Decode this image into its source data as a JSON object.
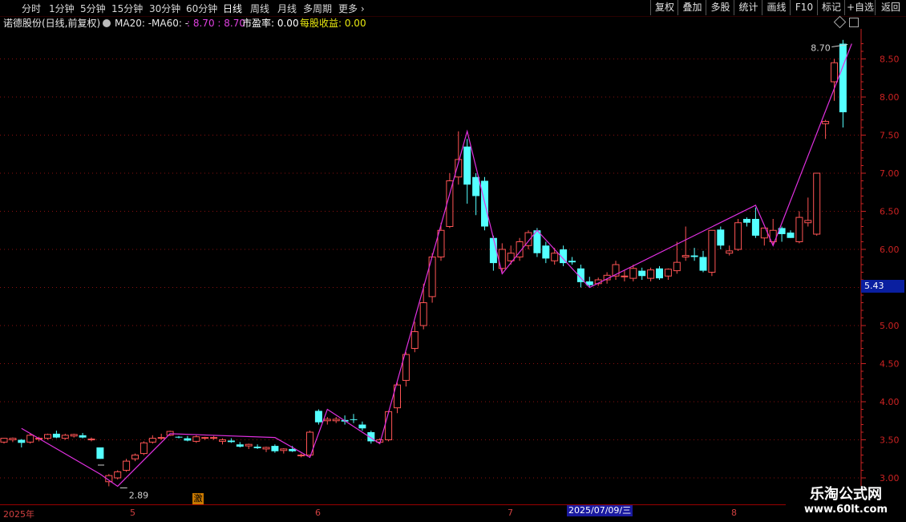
{
  "toolbar": {
    "periods": [
      "分时",
      "1分钟",
      "5分钟",
      "15分钟",
      "30分钟",
      "60分钟",
      "日线",
      "周线",
      "月线",
      "多周期",
      "更多 ›"
    ],
    "active_period": "日线",
    "right_buttons": [
      "复权",
      "叠加",
      "多股",
      "统计",
      "画线",
      "F10",
      "标记",
      "+自选",
      "返回"
    ]
  },
  "info": {
    "stock": "诺德股份(日线,前复权)",
    "ma20_label": "MA20: -",
    "ma60_label": "MA60: -",
    "ma_values": ": 8.70 : 8.70",
    "pe_label": "市盈率: 0.00",
    "eps_label": "每股收益: 0.00"
  },
  "panel_icons": [
    "diamond-icon",
    "window-icon"
  ],
  "current_price_tag": "5.43",
  "annotations": {
    "low_label": "2.89",
    "high_label": "8.70",
    "signal_flag": "激"
  },
  "date_axis": {
    "labels": [
      "2025年",
      "5",
      "6",
      "7",
      "8"
    ],
    "cursor_date": "2025/07/09/三"
  },
  "watermark": {
    "title": "乐淘公式网",
    "url": "www.60lt.com"
  },
  "colors": {
    "up": "#ff5454",
    "down": "#54ffff",
    "zigzag": "#e030e0",
    "axis": "#cc2222",
    "grid": "#8a1010"
  },
  "chart_data": {
    "type": "candlestick",
    "y_ticks": [
      3.0,
      3.5,
      4.0,
      4.5,
      5.0,
      5.5,
      6.0,
      6.5,
      7.0,
      7.5,
      8.0,
      8.5
    ],
    "ylim": [
      2.9,
      8.8
    ],
    "candles": [
      [
        3.47,
        3.52,
        3.45,
        3.52
      ],
      [
        3.5,
        3.53,
        3.47,
        3.52
      ],
      [
        3.5,
        3.51,
        3.4,
        3.46
      ],
      [
        3.47,
        3.58,
        3.45,
        3.56
      ],
      [
        3.51,
        3.54,
        3.48,
        3.52
      ],
      [
        3.52,
        3.58,
        3.5,
        3.57
      ],
      [
        3.58,
        3.62,
        3.52,
        3.53
      ],
      [
        3.52,
        3.58,
        3.5,
        3.56
      ],
      [
        3.55,
        3.58,
        3.53,
        3.57
      ],
      [
        3.56,
        3.59,
        3.52,
        3.53
      ],
      [
        3.5,
        3.53,
        3.48,
        3.51
      ],
      [
        3.4,
        3.4,
        3.25,
        3.25
      ],
      [
        2.95,
        3.05,
        2.89,
        3.03
      ],
      [
        3.0,
        3.1,
        2.98,
        3.08
      ],
      [
        3.1,
        3.25,
        3.08,
        3.22
      ],
      [
        3.25,
        3.32,
        3.22,
        3.3
      ],
      [
        3.32,
        3.48,
        3.3,
        3.46
      ],
      [
        3.47,
        3.56,
        3.45,
        3.52
      ],
      [
        3.52,
        3.58,
        3.5,
        3.53
      ],
      [
        3.56,
        3.62,
        3.55,
        3.61
      ],
      [
        3.54,
        3.55,
        3.52,
        3.53
      ],
      [
        3.52,
        3.55,
        3.48,
        3.49
      ],
      [
        3.48,
        3.56,
        3.46,
        3.54
      ],
      [
        3.52,
        3.54,
        3.5,
        3.53
      ],
      [
        3.52,
        3.55,
        3.5,
        3.53
      ],
      [
        3.48,
        3.52,
        3.44,
        3.5
      ],
      [
        3.49,
        3.52,
        3.46,
        3.47
      ],
      [
        3.44,
        3.47,
        3.4,
        3.41
      ],
      [
        3.42,
        3.45,
        3.38,
        3.44
      ],
      [
        3.41,
        3.44,
        3.38,
        3.39
      ],
      [
        3.38,
        3.41,
        3.34,
        3.4
      ],
      [
        3.42,
        3.44,
        3.33,
        3.35
      ],
      [
        3.36,
        3.39,
        3.32,
        3.38
      ],
      [
        3.38,
        3.42,
        3.34,
        3.35
      ],
      [
        3.3,
        3.32,
        3.27,
        3.3
      ],
      [
        3.3,
        3.62,
        3.28,
        3.6
      ],
      [
        3.88,
        3.9,
        3.7,
        3.73
      ],
      [
        3.75,
        3.8,
        3.7,
        3.77
      ],
      [
        3.75,
        3.8,
        3.72,
        3.77
      ],
      [
        3.76,
        3.82,
        3.7,
        3.74
      ],
      [
        3.77,
        3.84,
        3.72,
        3.76
      ],
      [
        3.7,
        3.74,
        3.62,
        3.65
      ],
      [
        3.6,
        3.62,
        3.45,
        3.48
      ],
      [
        3.47,
        3.52,
        3.45,
        3.5
      ],
      [
        3.5,
        3.88,
        3.48,
        3.87
      ],
      [
        3.92,
        4.25,
        3.85,
        4.22
      ],
      [
        4.28,
        4.65,
        4.2,
        4.62
      ],
      [
        4.7,
        5.05,
        4.65,
        4.92
      ],
      [
        5.0,
        5.55,
        4.95,
        5.3
      ],
      [
        5.38,
        5.95,
        5.3,
        5.9
      ],
      [
        5.9,
        6.35,
        5.85,
        6.25
      ],
      [
        6.3,
        7.0,
        6.28,
        6.9
      ],
      [
        6.95,
        7.55,
        6.85,
        7.18
      ],
      [
        7.35,
        7.45,
        6.6,
        6.85
      ],
      [
        6.95,
        7.0,
        6.45,
        6.7
      ],
      [
        6.9,
        6.95,
        6.25,
        6.3
      ],
      [
        6.15,
        6.18,
        5.72,
        5.82
      ],
      [
        5.75,
        6.08,
        5.7,
        6.0
      ],
      [
        5.85,
        6.05,
        5.8,
        5.95
      ],
      [
        5.9,
        6.15,
        5.85,
        6.1
      ],
      [
        6.05,
        6.25,
        6.0,
        6.22
      ],
      [
        6.25,
        6.28,
        5.9,
        5.95
      ],
      [
        6.05,
        6.1,
        5.82,
        5.88
      ],
      [
        5.85,
        6.02,
        5.8,
        5.95
      ],
      [
        6.0,
        6.05,
        5.78,
        5.82
      ],
      [
        5.85,
        5.9,
        5.8,
        5.83
      ],
      [
        5.75,
        5.8,
        5.5,
        5.57
      ],
      [
        5.58,
        5.64,
        5.5,
        5.53
      ],
      [
        5.55,
        5.63,
        5.52,
        5.6
      ],
      [
        5.6,
        5.7,
        5.55,
        5.66
      ],
      [
        5.65,
        5.85,
        5.6,
        5.8
      ],
      [
        5.65,
        5.72,
        5.58,
        5.65
      ],
      [
        5.62,
        5.8,
        5.58,
        5.75
      ],
      [
        5.72,
        5.76,
        5.6,
        5.65
      ],
      [
        5.62,
        5.76,
        5.58,
        5.73
      ],
      [
        5.75,
        5.78,
        5.6,
        5.62
      ],
      [
        5.65,
        5.75,
        5.6,
        5.74
      ],
      [
        5.72,
        6.1,
        5.68,
        5.83
      ],
      [
        5.9,
        6.3,
        5.85,
        5.92
      ],
      [
        5.92,
        6.02,
        5.85,
        5.9
      ],
      [
        5.9,
        5.98,
        5.7,
        5.72
      ],
      [
        5.7,
        6.25,
        5.65,
        6.25
      ],
      [
        6.26,
        6.3,
        6.0,
        6.05
      ],
      [
        5.95,
        6.05,
        5.92,
        5.98
      ],
      [
        6.0,
        6.4,
        5.98,
        6.35
      ],
      [
        6.4,
        6.42,
        6.3,
        6.35
      ],
      [
        6.4,
        6.55,
        6.15,
        6.18
      ],
      [
        6.15,
        6.28,
        6.05,
        6.28
      ],
      [
        6.1,
        6.4,
        6.05,
        6.25
      ],
      [
        6.28,
        6.3,
        6.1,
        6.2
      ],
      [
        6.22,
        6.25,
        6.15,
        6.15
      ],
      [
        6.1,
        6.5,
        6.08,
        6.42
      ],
      [
        6.35,
        6.68,
        6.3,
        6.38
      ],
      [
        6.2,
        7.0,
        6.18,
        7.0
      ],
      [
        7.65,
        7.7,
        7.45,
        7.68
      ],
      [
        8.2,
        8.5,
        7.95,
        8.45
      ],
      [
        8.7,
        8.75,
        7.6,
        7.8
      ]
    ],
    "zigzag": [
      [
        2,
        3.65
      ],
      [
        11,
        3.05
      ],
      [
        13,
        2.89
      ],
      [
        19,
        3.58
      ],
      [
        31,
        3.53
      ],
      [
        35,
        3.27
      ],
      [
        37,
        3.9
      ],
      [
        43,
        3.45
      ],
      [
        53,
        7.55
      ],
      [
        57,
        5.68
      ],
      [
        61,
        6.25
      ],
      [
        67,
        5.5
      ],
      [
        86,
        6.58
      ],
      [
        88,
        6.05
      ],
      [
        97,
        8.7
      ]
    ]
  }
}
